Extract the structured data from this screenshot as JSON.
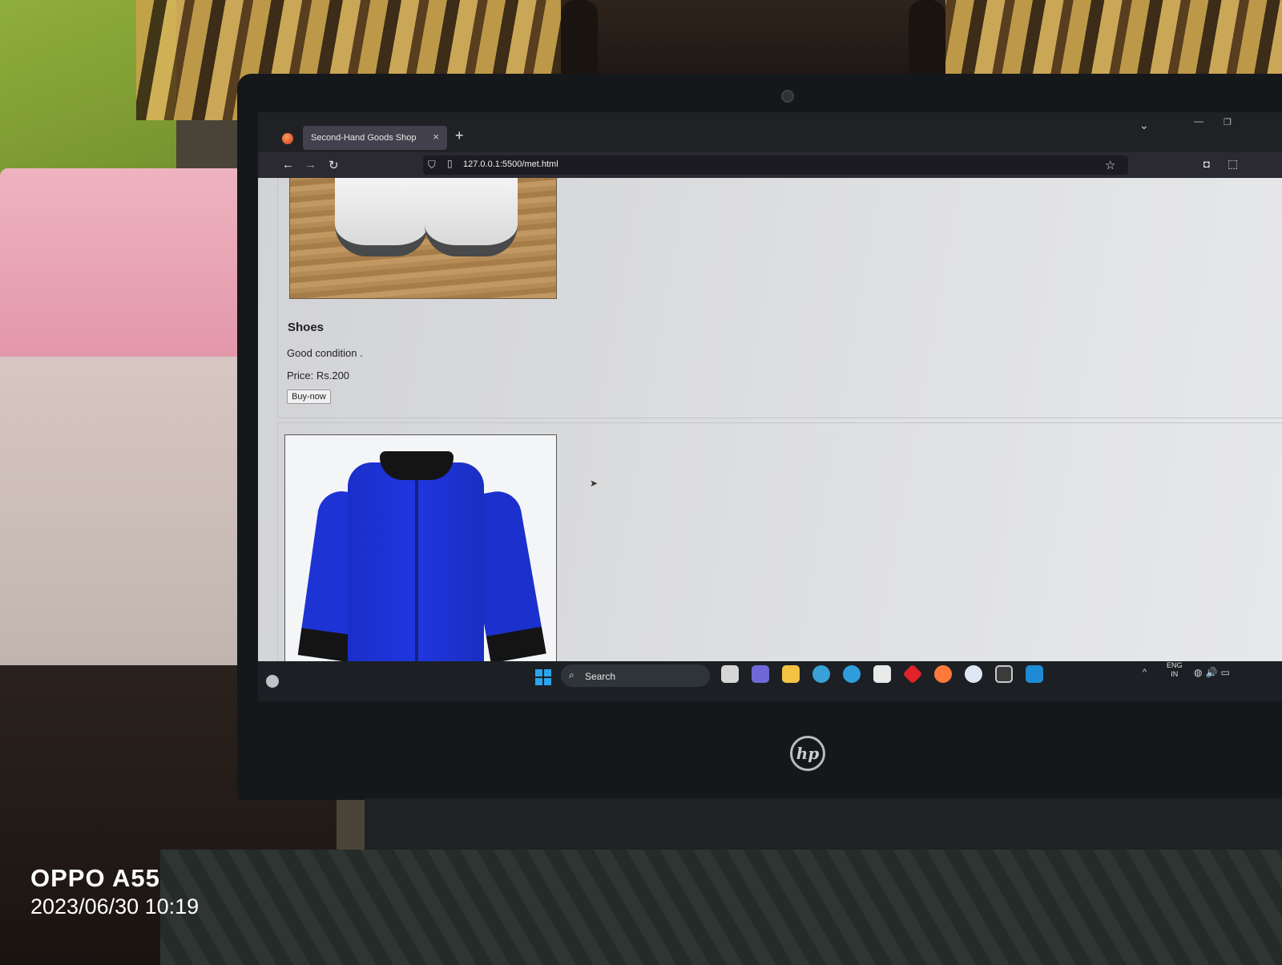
{
  "browser": {
    "tab_title": "Second-Hand Goods Shop",
    "tab_close": "×",
    "new_tab": "+",
    "url": "127.0.0.1:5500/met.html"
  },
  "products": [
    {
      "title": "Shoes",
      "description": "Good condition .",
      "price": "Price: Rs.200",
      "buy_label": "Buy-now"
    }
  ],
  "taskbar": {
    "search_label": "Search",
    "lang_line1": "ENG",
    "lang_line2": "IN",
    "pinned_icons": [
      "task-view-icon",
      "teams-icon",
      "file-explorer-icon",
      "firefox-nightly-icon",
      "edge-icon",
      "store-icon",
      "app-red-icon",
      "firefox-icon",
      "app-circle-icon",
      "m-app-icon",
      "vscode-icon"
    ]
  },
  "photo_watermark": {
    "model": "OPPO A55",
    "datetime": "2023/06/30 10:19"
  },
  "colors": {
    "browser_chrome": "#2b2a33",
    "taskbar": "#1c2024",
    "shirt": "#1f35d8"
  }
}
